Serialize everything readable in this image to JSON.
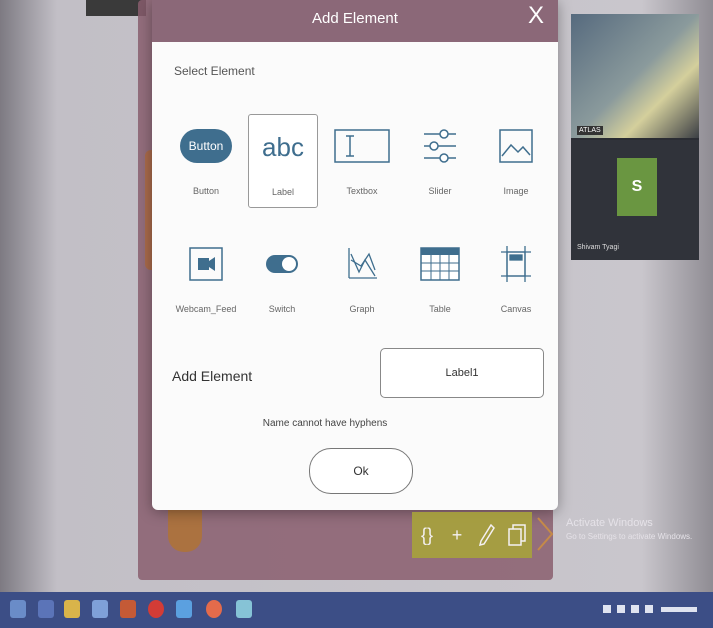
{
  "dialog": {
    "title": "Add Element",
    "close_label": "X",
    "select_label": "Select Element",
    "add_label": "Add Element",
    "name_value": "Label1",
    "error": "Name cannot have hyphens",
    "ok_label": "Ok"
  },
  "elements": [
    {
      "label": "Button",
      "icon": "button-icon",
      "icon_text": "Button"
    },
    {
      "label": "Label",
      "icon": "label-icon",
      "icon_text": "abc",
      "selected": true
    },
    {
      "label": "Textbox",
      "icon": "textbox-icon"
    },
    {
      "label": "Slider",
      "icon": "slider-icon"
    },
    {
      "label": "Image",
      "icon": "image-icon"
    },
    {
      "label": "Webcam_Feed",
      "icon": "webcam-icon"
    },
    {
      "label": "Switch",
      "icon": "switch-icon"
    },
    {
      "label": "Graph",
      "icon": "graph-icon"
    },
    {
      "label": "Table",
      "icon": "table-icon"
    },
    {
      "label": "Canvas",
      "icon": "canvas-icon"
    }
  ],
  "video": {
    "tile_tag": "ATLAS",
    "avatar_letter": "S",
    "participant_name": "Shivam Tyagi"
  },
  "toolbar": {
    "braces": "{}",
    "plus": "+"
  },
  "watermark": {
    "line1": "Activate Windows",
    "line2": "Go to Settings to activate Windows."
  },
  "colors": {
    "header": "#8b6878",
    "accent": "#3f6e8e",
    "toolbar": "#a8a33c",
    "taskbar": "#3c4e86"
  }
}
